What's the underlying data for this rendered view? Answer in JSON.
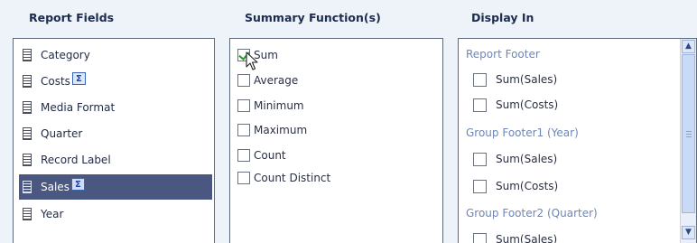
{
  "headers": {
    "report_fields": "Report Fields",
    "summary_functions": "Summary Function(s)",
    "display_in": "Display In"
  },
  "report_fields": [
    {
      "label": "Category",
      "summary": false,
      "selected": false
    },
    {
      "label": "Costs",
      "summary": true,
      "selected": false
    },
    {
      "label": "Media Format",
      "summary": false,
      "selected": false
    },
    {
      "label": "Quarter",
      "summary": false,
      "selected": false
    },
    {
      "label": "Record Label",
      "summary": false,
      "selected": false
    },
    {
      "label": "Sales",
      "summary": true,
      "selected": true
    },
    {
      "label": "Year",
      "summary": false,
      "selected": false
    }
  ],
  "summary_functions": [
    {
      "label": "Sum",
      "checked": true
    },
    {
      "label": "Average",
      "checked": false
    },
    {
      "label": "Minimum",
      "checked": false
    },
    {
      "label": "Maximum",
      "checked": false
    },
    {
      "label": "Count",
      "checked": false
    },
    {
      "label": "Count Distinct",
      "checked": false
    }
  ],
  "display_in": [
    {
      "group": "Report Footer",
      "items": [
        "Sum(Sales)",
        "Sum(Costs)"
      ]
    },
    {
      "group": "Group Footer1 (Year)",
      "items": [
        "Sum(Sales)",
        "Sum(Costs)"
      ]
    },
    {
      "group": "Group Footer2 (Quarter)",
      "items": [
        "Sum(Sales)"
      ]
    }
  ],
  "icons": {
    "sigma_glyph": "Σ",
    "scroll_up": "▲",
    "scroll_down": "▼"
  },
  "colors": {
    "selection": "#4a5780",
    "check": "#2b9a2b",
    "group_label": "#6d87b8"
  }
}
